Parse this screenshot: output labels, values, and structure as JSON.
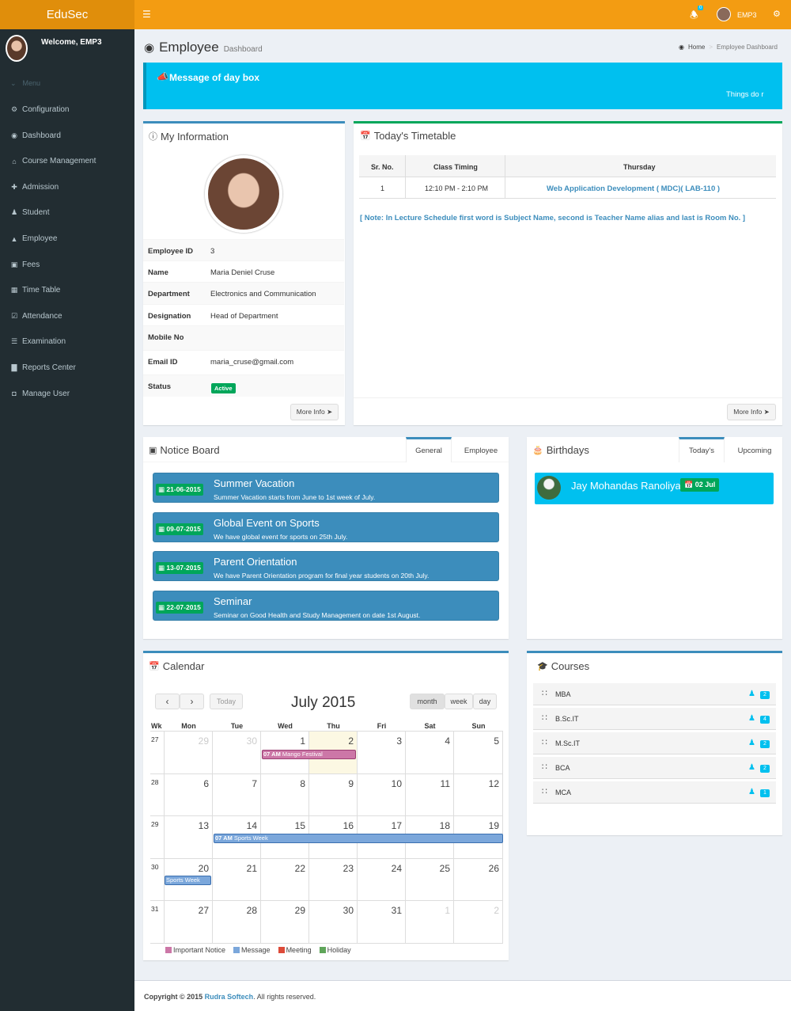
{
  "app": {
    "brand": "EduSec",
    "welcome": "Welcome, EMP3",
    "username": "EMP3",
    "notif_count": "0"
  },
  "sidebar": {
    "menu_label": "Menu",
    "items": [
      {
        "label": "Configuration",
        "icon": "gears-icon"
      },
      {
        "label": "Dashboard",
        "icon": "dashboard-icon"
      },
      {
        "label": "Course Management",
        "icon": "graduation-cap-icon"
      },
      {
        "label": "Admission",
        "icon": "user-plus-icon"
      },
      {
        "label": "Student",
        "icon": "users-icon"
      },
      {
        "label": "Employee",
        "icon": "user-icon"
      },
      {
        "label": "Fees",
        "icon": "money-icon"
      },
      {
        "label": "Time Table",
        "icon": "calendar-icon"
      },
      {
        "label": "Attendance",
        "icon": "check-square-icon"
      },
      {
        "label": "Examination",
        "icon": "file-text-icon"
      },
      {
        "label": "Reports Center",
        "icon": "bar-chart-icon"
      },
      {
        "label": "Manage User",
        "icon": "lock-icon"
      }
    ]
  },
  "page": {
    "title": "Employee",
    "subtitle": "Dashboard",
    "breadcrumb_home": "Home",
    "breadcrumb_current": "Employee Dashboard"
  },
  "message_box": {
    "title": "Message of day box",
    "marquee": "Things do r"
  },
  "my_info": {
    "title": "My Information",
    "rows": [
      {
        "k": "Employee ID",
        "v": "3"
      },
      {
        "k": "Name",
        "v": "Maria Deniel Cruse"
      },
      {
        "k": "Department",
        "v": "Electronics and Communication"
      },
      {
        "k": "Designation",
        "v": "Head of Department"
      },
      {
        "k": "Mobile No",
        "v": ""
      },
      {
        "k": "Email ID",
        "v": "maria_cruse@gmail.com"
      },
      {
        "k": "Status",
        "v": ""
      }
    ],
    "status": "Active",
    "more": "More Info"
  },
  "timetable": {
    "title": "Today's Timetable",
    "headers": [
      "Sr. No.",
      "Class Timing",
      "Thursday"
    ],
    "row": [
      "1",
      "12:10 PM - 2:10 PM",
      "Web Application Development ( MDC)( LAB-110 )"
    ],
    "note": "[ Note: In Lecture Schedule first word is Subject Name, second is Teacher Name alias and last is Room No. ]",
    "more": "More Info"
  },
  "notice_board": {
    "title": "Notice Board",
    "tabs": [
      "General",
      "Employee"
    ],
    "items": [
      {
        "date": "21-06-2015",
        "title": "Summer Vacation",
        "text": "Summer Vacation starts from June to 1st week of July."
      },
      {
        "date": "09-07-2015",
        "title": "Global Event on Sports",
        "text": "We have global event for sports on 25th July."
      },
      {
        "date": "13-07-2015",
        "title": "Parent Orientation",
        "text": "We have Parent Orientation program for final year students on 20th July."
      },
      {
        "date": "22-07-2015",
        "title": "Seminar",
        "text": "Seminar on Good Health and Study Management on date 1st August."
      }
    ]
  },
  "birthdays": {
    "title": "Birthdays",
    "tabs": [
      "Today's",
      "Upcoming"
    ],
    "person": "Jay Mohandas Ranoliya",
    "date": "02 Jul"
  },
  "calendar": {
    "title": "Calendar",
    "month": "July 2015",
    "today": "Today",
    "views": [
      "month",
      "week",
      "day"
    ],
    "wk": "Wk",
    "days": [
      "Mon",
      "Tue",
      "Wed",
      "Thu",
      "Fri",
      "Sat",
      "Sun"
    ],
    "weeks": [
      {
        "wk": "27",
        "d": [
          "29",
          "30",
          "1",
          "2",
          "3",
          "4",
          "5"
        ]
      },
      {
        "wk": "28",
        "d": [
          "6",
          "7",
          "8",
          "9",
          "10",
          "11",
          "12"
        ]
      },
      {
        "wk": "29",
        "d": [
          "13",
          "14",
          "15",
          "16",
          "17",
          "18",
          "19"
        ]
      },
      {
        "wk": "30",
        "d": [
          "20",
          "21",
          "22",
          "23",
          "24",
          "25",
          "26"
        ]
      },
      {
        "wk": "31",
        "d": [
          "27",
          "28",
          "29",
          "30",
          "31",
          "1",
          "2"
        ]
      }
    ],
    "events": {
      "mango_time": "07 AM",
      "mango": "Mango Festival",
      "sports_time": "07 AM",
      "sports": "Sports Week",
      "sports_cont": "Sports Week"
    },
    "legend": [
      "Important Notice",
      "Message",
      "Meeting",
      "Holiday"
    ],
    "legend_colors": [
      "#cc77a7",
      "#7ba7db",
      "#dd4b39",
      "#5fa55a"
    ]
  },
  "courses": {
    "title": "Courses",
    "items": [
      {
        "name": "MBA",
        "count": "2"
      },
      {
        "name": "B.Sc.IT",
        "count": "4"
      },
      {
        "name": "M.Sc.IT",
        "count": "2"
      },
      {
        "name": "BCA",
        "count": "2"
      },
      {
        "name": "MCA",
        "count": "1"
      }
    ]
  },
  "footer": {
    "copyright": "Copyright © 2015",
    "company": "Rudra Softech",
    "rights": ". All rights reserved."
  }
}
